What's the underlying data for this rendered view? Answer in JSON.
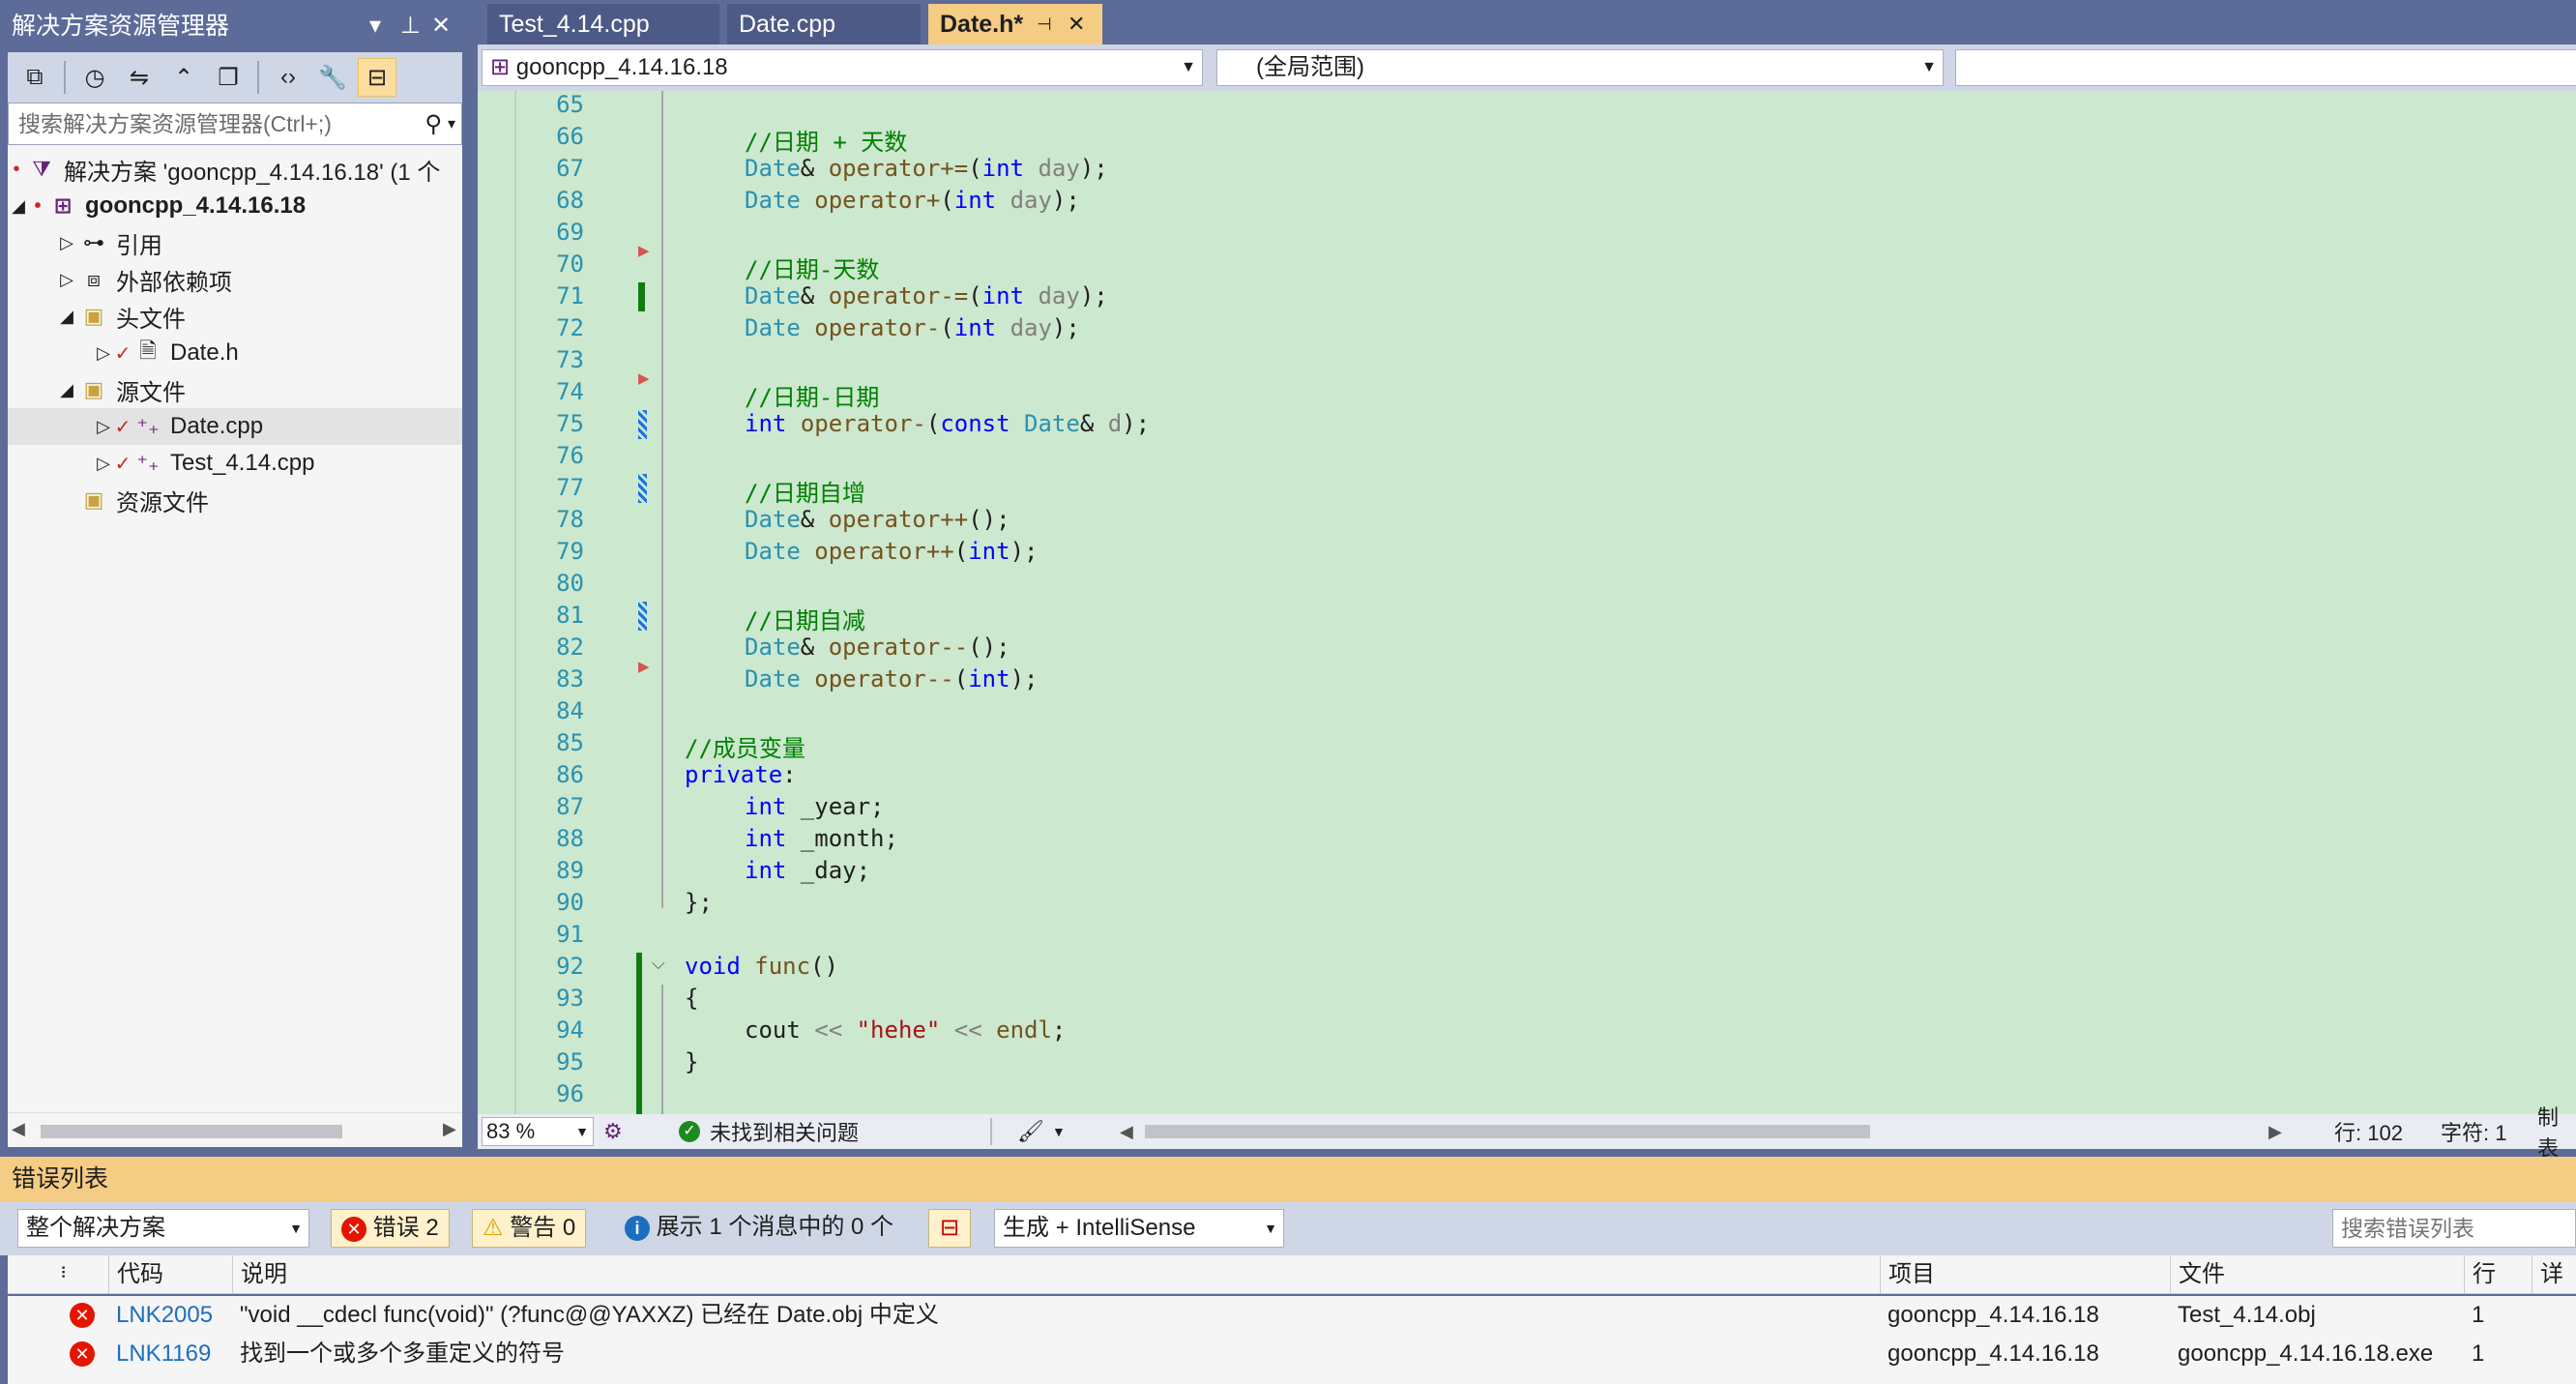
{
  "solution_explorer": {
    "title": "解决方案资源管理器",
    "search_placeholder": "搜索解决方案资源管理器(Ctrl+;)",
    "tree": [
      {
        "label": "解决方案 'gooncpp_4.14.16.18' (1 个"
      },
      {
        "label": "gooncpp_4.14.16.18"
      },
      {
        "label": "引用"
      },
      {
        "label": "外部依赖项"
      },
      {
        "label": "头文件"
      },
      {
        "label": "Date.h"
      },
      {
        "label": "源文件"
      },
      {
        "label": "Date.cpp"
      },
      {
        "label": "Test_4.14.cpp"
      },
      {
        "label": "资源文件"
      }
    ]
  },
  "tabs": [
    {
      "label": "Test_4.14.cpp"
    },
    {
      "label": "Date.cpp"
    },
    {
      "label": "Date.h*"
    }
  ],
  "navbar": {
    "project": "gooncpp_4.14.16.18",
    "scope": "(全局范围)"
  },
  "code": {
    "line_numbers": [
      "65",
      "66",
      "67",
      "68",
      "69",
      "70",
      "71",
      "72",
      "73",
      "74",
      "75",
      "76",
      "77",
      "78",
      "79",
      "80",
      "81",
      "82",
      "83",
      "84",
      "85",
      "86",
      "87",
      "88",
      "89",
      "90",
      "91",
      "92",
      "93",
      "94",
      "95",
      "96"
    ],
    "l66": "//日期 + 天数",
    "l70": "//日期-天数",
    "l74": "//日期-日期",
    "l77": "//日期自增",
    "l81": "//日期自减",
    "l85": "//成员变量",
    "string_hehe": "\"hehe\""
  },
  "editor_status": {
    "zoom": "83 %",
    "issues": "未找到相关问题",
    "row": "行: 102",
    "col": "字符: 1",
    "mode": "制表"
  },
  "error_list": {
    "title": "错误列表",
    "scope": "整个解决方案",
    "errors_btn": "错误 2",
    "warnings_btn": "警告 0",
    "messages_btn": "展示 1 个消息中的 0 个",
    "build_filter": "生成 + IntelliSense",
    "search_placeholder": "搜索错误列表",
    "columns": [
      "代码",
      "说明",
      "项目",
      "文件",
      "行",
      "详细"
    ],
    "rows": [
      {
        "code": "LNK2005",
        "desc": "\"void __cdecl func(void)\" (?func@@YAXXZ) 已经在 Date.obj 中定义",
        "project": "gooncpp_4.14.16.18",
        "file": "Test_4.14.obj",
        "line": "1"
      },
      {
        "code": "LNK1169",
        "desc": "找到一个或多个多重定义的符号",
        "project": "gooncpp_4.14.16.18",
        "file": "gooncpp_4.14.16.18.exe",
        "line": "1"
      }
    ]
  },
  "colors": {
    "editor_bg": "#cce8cf",
    "chrome": "#5d6b99",
    "active_tab": "#f5cc84",
    "keyword": "#0000ff",
    "type": "#2b91af",
    "comment": "#008000",
    "error": "#e51400"
  }
}
